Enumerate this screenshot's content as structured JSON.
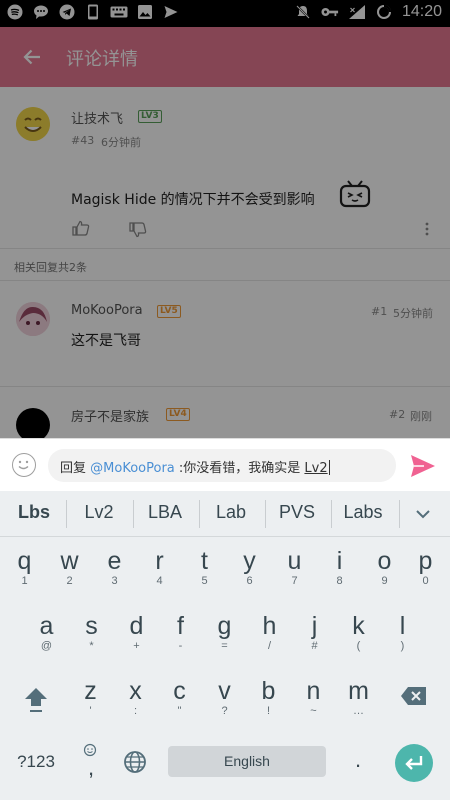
{
  "status_bar": {
    "time": "14:20",
    "left_icons": [
      "spotify-icon",
      "message-bubble-icon",
      "telegram-icon",
      "phone-icon",
      "keyboard-icon",
      "image-icon",
      "send-icon"
    ],
    "right_icons": [
      "mute-icon",
      "key-icon",
      "signal-icon",
      "sync-icon"
    ]
  },
  "app_bar": {
    "title": "评论详情",
    "back_icon": "arrow-left-icon",
    "background": "#e57791"
  },
  "main_comment": {
    "username": "让技术飞",
    "level": "LV3",
    "floor": "#43",
    "time": "6分钟前",
    "text": "Magisk Hide 的情况下并不会受到影响",
    "emote": "bilibili-tv-icon"
  },
  "replies_header": "相关回复共2条",
  "replies": [
    {
      "username": "MoKooPora",
      "level": "LV5",
      "floor": "#1",
      "time": "5分钟前",
      "text": "这不是飞哥"
    },
    {
      "username": "房子不是家族",
      "level": "LV4",
      "floor": "#2",
      "time": "刚刚",
      "text": ""
    }
  ],
  "reply_bar": {
    "prefix": "回复",
    "mention": "@MoKooPora",
    "text": ":你没看错，我确实是 ",
    "typed": "Lv2",
    "accent": "#f06292"
  },
  "keyboard": {
    "suggestions": [
      "Lbs",
      "Lv2",
      "LBA",
      "Lab",
      "PVS",
      "Labs"
    ],
    "row1": [
      {
        "k": "q",
        "s": "1"
      },
      {
        "k": "w",
        "s": "2"
      },
      {
        "k": "e",
        "s": "3"
      },
      {
        "k": "r",
        "s": "4"
      },
      {
        "k": "t",
        "s": "5"
      },
      {
        "k": "y",
        "s": "6"
      },
      {
        "k": "u",
        "s": "7"
      },
      {
        "k": "i",
        "s": "8"
      },
      {
        "k": "o",
        "s": "9"
      },
      {
        "k": "p",
        "s": "0"
      }
    ],
    "row2": [
      {
        "k": "a",
        "s": "@"
      },
      {
        "k": "s",
        "s": "*"
      },
      {
        "k": "d",
        "s": "+"
      },
      {
        "k": "f",
        "s": "-"
      },
      {
        "k": "g",
        "s": "="
      },
      {
        "k": "h",
        "s": "/"
      },
      {
        "k": "j",
        "s": "#"
      },
      {
        "k": "k",
        "s": "("
      },
      {
        "k": "l",
        "s": ")"
      }
    ],
    "row3": [
      {
        "k": "z",
        "s": "'"
      },
      {
        "k": "x",
        "s": ":"
      },
      {
        "k": "c",
        "s": "\""
      },
      {
        "k": "v",
        "s": "?"
      },
      {
        "k": "b",
        "s": "!"
      },
      {
        "k": "n",
        "s": "~"
      },
      {
        "k": "m",
        "s": "…"
      }
    ],
    "symbols_key": "?123",
    "comma_key": ",",
    "space_label": "English",
    "period_key": ".",
    "enter_color": "#4db6ac"
  }
}
